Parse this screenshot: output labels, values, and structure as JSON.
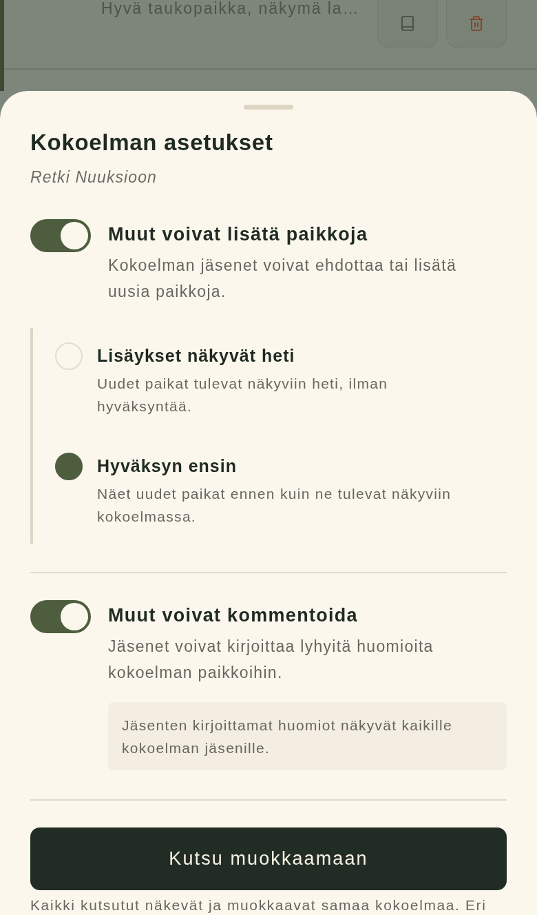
{
  "background_list": {
    "item_snippet": "Hyvä taukopaikka, näkymä la…"
  },
  "sheet": {
    "title": "Kokoelman asetukset",
    "subtitle": "Retki Nuuksioon",
    "settings": [
      {
        "label": "Muut voivat lisätä paikkoja",
        "description": "Kokoelman jäsenet voivat ehdottaa tai lisätä uusia paikkoja.",
        "on": true,
        "options": [
          {
            "label": "Lisäykset näkyvät heti",
            "description": "Uudet paikat tulevat näkyviin heti, ilman hyväksyntää.",
            "selected": false
          },
          {
            "label": "Hyväksyn ensin",
            "description": "Näet uudet paikat ennen kuin ne tulevat näkyviin kokoelmassa.",
            "selected": true
          }
        ]
      },
      {
        "label": "Muut voivat kommentoida",
        "description": "Jäsenet voivat kirjoittaa lyhyitä huomioita kokoelman paikkoihin.",
        "on": true,
        "note": "Jäsenten kirjoittamat huomiot näkyvät kaikille kokoelman jäsenille."
      }
    ],
    "invite_button": "Kutsu muokkaamaan",
    "footer_note": "Kaikki kutsutut näkevät ja muokkaavat samaa kokoelmaa. Eri"
  }
}
